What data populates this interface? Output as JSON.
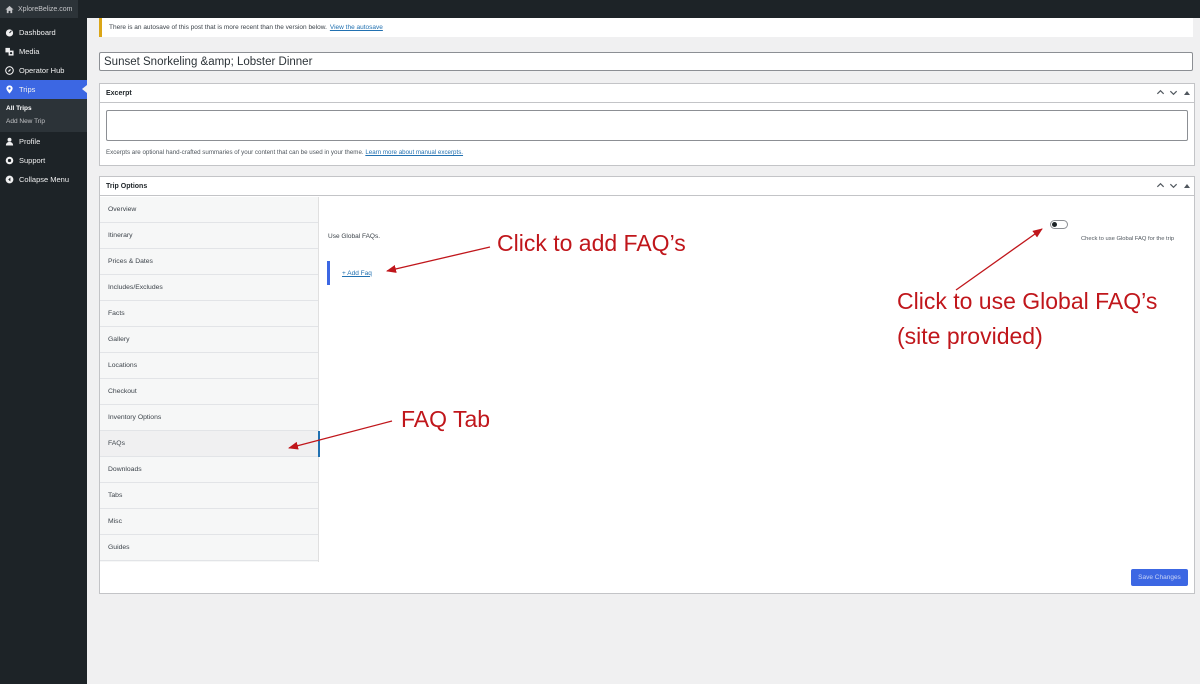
{
  "adminbar": {
    "site_name": "XploreBelize.com"
  },
  "sidebar": {
    "items": [
      {
        "label": "Dashboard",
        "icon": "dashboard-icon"
      },
      {
        "label": "Media",
        "icon": "media-icon"
      },
      {
        "label": "Operator Hub",
        "icon": "compass-icon"
      },
      {
        "label": "Trips",
        "icon": "location-pin-icon"
      }
    ],
    "submenu": [
      "All Trips",
      "Add New Trip"
    ],
    "items_after": [
      {
        "label": "Profile",
        "icon": "user-icon"
      },
      {
        "label": "Support",
        "icon": "support-icon"
      },
      {
        "label": "Collapse Menu",
        "icon": "collapse-icon"
      }
    ]
  },
  "notice": {
    "text": "There is an autosave of this post that is more recent than the version below.",
    "link": "View the autosave"
  },
  "post_title": "Sunset Snorkeling &amp; Lobster Dinner",
  "excerpt": {
    "title": "Excerpt",
    "note": "Excerpts are optional hand-crafted summaries of your content that can be used in your theme.",
    "note_link": "Learn more about manual excerpts."
  },
  "trip_options": {
    "title": "Trip Options",
    "tabs": [
      "Overview",
      "Itinerary",
      "Prices & Dates",
      "Includes/Excludes",
      "Facts",
      "Gallery",
      "Locations",
      "Checkout",
      "Inventory Options",
      "FAQs",
      "Downloads",
      "Tabs",
      "Misc",
      "Guides"
    ],
    "active_tab": "FAQs",
    "use_global_label": "Use Global FAQs.",
    "toggle_hint": "Check to use Global FAQ for the trip",
    "add_faq": "+ Add Faq",
    "save_button": "Save Changes"
  },
  "annotations": {
    "add_faq": "Click to add FAQ’s",
    "global_line1": "Click to use Global FAQ’s",
    "global_line2": "(site provided)",
    "faq_tab": "FAQ Tab"
  },
  "colors": {
    "accent": "#3c67e3",
    "annotation": "#c0161b",
    "sidebar": "#1d2327"
  }
}
